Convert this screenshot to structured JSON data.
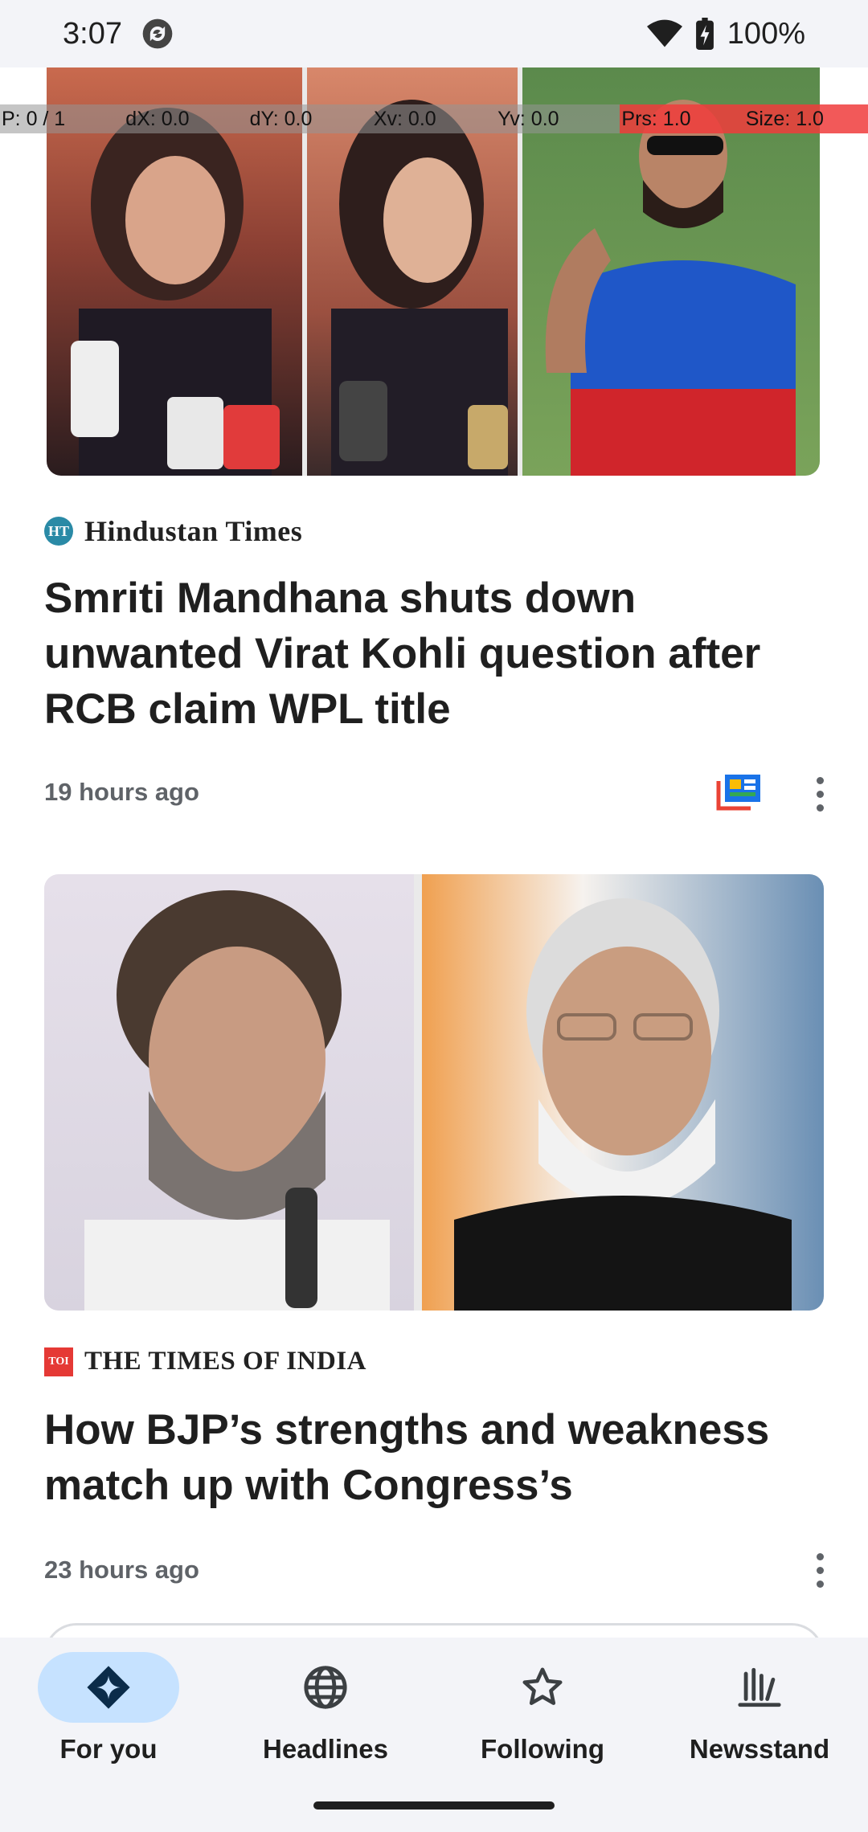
{
  "status_bar": {
    "time": "3:07",
    "battery": "100%",
    "icons": [
      "sync-icon",
      "wifi-icon",
      "battery-charging-icon"
    ]
  },
  "debug_overlay": {
    "cells": [
      "P: 0 / 1",
      "dX: 0.0",
      "dY: 0.0",
      "Xv: 0.0",
      "Yv: 0.0",
      "Prs: 1.0",
      "Size: 1.0"
    ]
  },
  "articles": [
    {
      "source": "Hindustan Times",
      "source_logo": "HT",
      "headline": "Smriti Mandhana shuts down unwanted Virat Kohli question after RCB claim WPL title",
      "time_ago": "19 hours ago",
      "has_full_coverage": true
    },
    {
      "source": "THE TIMES OF INDIA",
      "source_logo": "TOI",
      "headline": "How BJP’s strengths and weakness match up with Congress’s",
      "time_ago": "23 hours ago",
      "has_full_coverage": false
    }
  ],
  "bottom_nav": {
    "items": [
      {
        "label": "For you",
        "icon": "for-you-icon",
        "active": true
      },
      {
        "label": "Headlines",
        "icon": "globe-icon",
        "active": false
      },
      {
        "label": "Following",
        "icon": "star-icon",
        "active": false
      },
      {
        "label": "Newsstand",
        "icon": "newsstand-icon",
        "active": false
      }
    ]
  },
  "colors": {
    "accent_active_pill": "#c6e2ff",
    "nav_background": "#f3f4f8",
    "ht_logo": "#2a8aa6",
    "toi_logo": "#e53935"
  }
}
